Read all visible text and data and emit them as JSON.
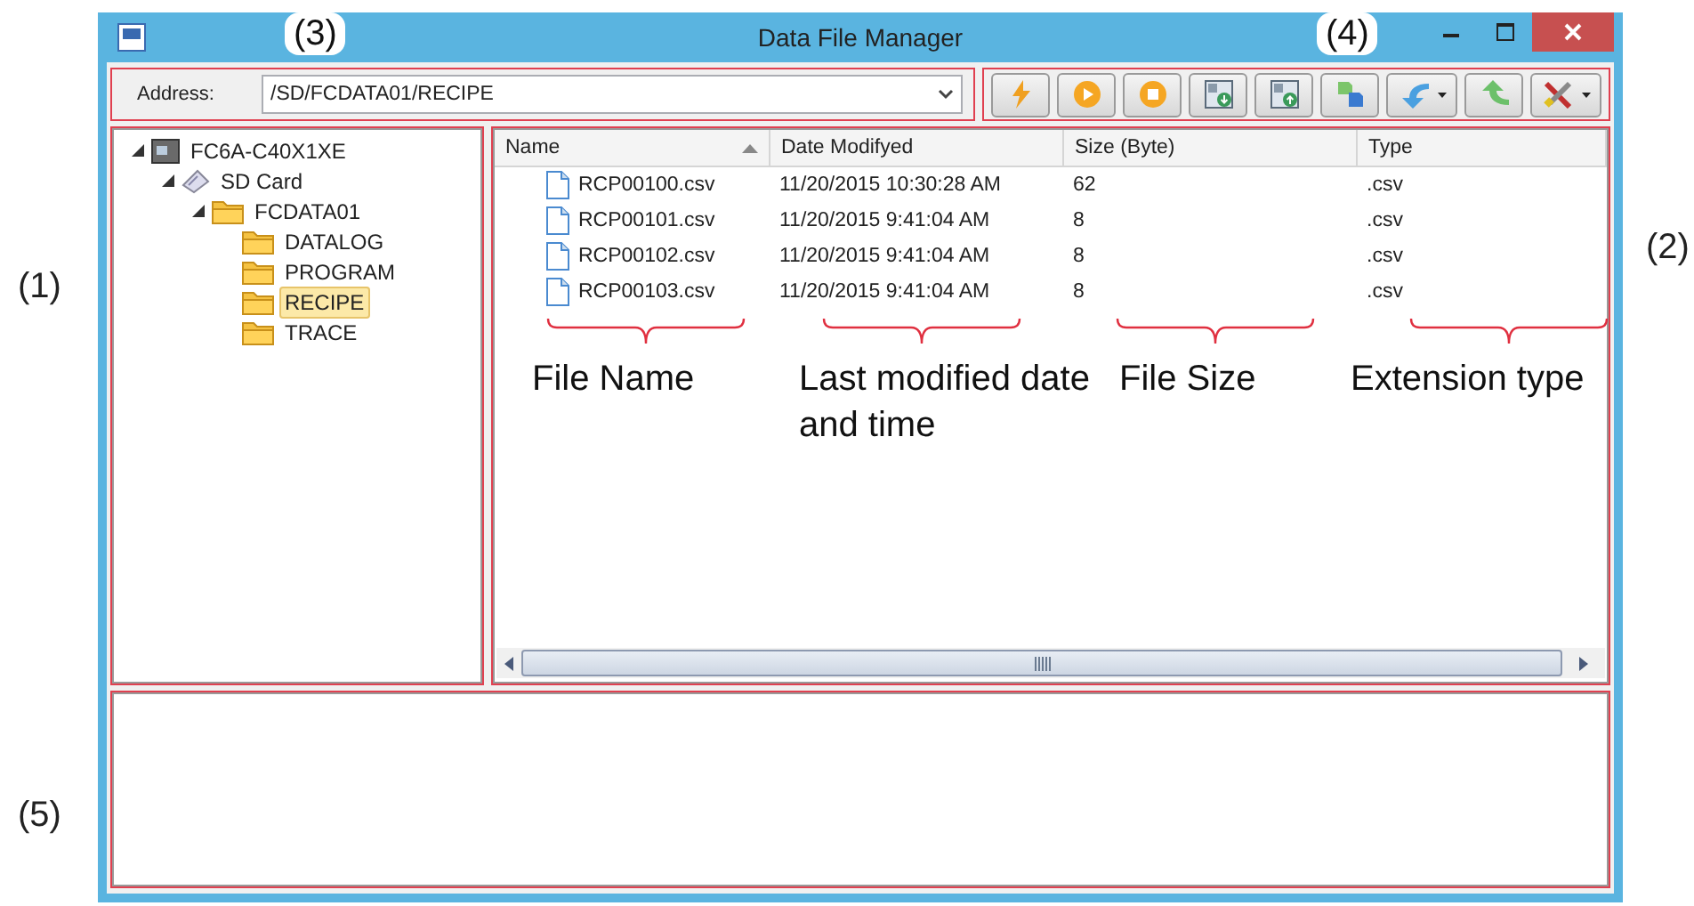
{
  "window": {
    "title": "Data File Manager"
  },
  "address_bar": {
    "callout": "(3)",
    "label": "Address:",
    "value": "/SD/FCDATA01/RECIPE"
  },
  "toolbar": {
    "callout": "(4)",
    "buttons": [
      {
        "kind": "plain"
      },
      {
        "kind": "plain"
      },
      {
        "kind": "plain"
      },
      {
        "kind": "plain"
      },
      {
        "kind": "plain"
      },
      {
        "kind": "plain"
      },
      {
        "kind": "split"
      },
      {
        "kind": "plain"
      },
      {
        "kind": "split"
      }
    ]
  },
  "tree": {
    "callout": "(1)",
    "items": [
      {
        "label": "FC6A-C40X1XE",
        "kind": "device",
        "expanded": true,
        "selected": false,
        "children": [
          {
            "label": "SD Card",
            "kind": "card",
            "expanded": true,
            "selected": false,
            "children": [
              {
                "label": "FCDATA01",
                "kind": "folder",
                "expanded": true,
                "selected": false,
                "children": [
                  {
                    "label": "DATALOG",
                    "kind": "folder",
                    "selected": false
                  },
                  {
                    "label": "PROGRAM",
                    "kind": "folder",
                    "selected": false
                  },
                  {
                    "label": "RECIPE",
                    "kind": "folder",
                    "selected": true
                  },
                  {
                    "label": "TRACE",
                    "kind": "folder",
                    "selected": false
                  }
                ]
              }
            ]
          }
        ]
      }
    ]
  },
  "file_list": {
    "callout": "(2)",
    "columns": [
      {
        "label": "Name",
        "sorted": true
      },
      {
        "label": "Date Modifyed",
        "sorted": false
      },
      {
        "label": "Size  (Byte)",
        "sorted": false
      },
      {
        "label": "Type",
        "sorted": false
      }
    ],
    "rows": [
      {
        "name": "RCP00100.csv",
        "date": "11/20/2015 10:30:28 AM",
        "size": "62",
        "type": ".csv"
      },
      {
        "name": "RCP00101.csv",
        "date": "11/20/2015 9:41:04 AM",
        "size": "8",
        "type": ".csv"
      },
      {
        "name": "RCP00102.csv",
        "date": "11/20/2015 9:41:04 AM",
        "size": "8",
        "type": ".csv"
      },
      {
        "name": "RCP00103.csv",
        "date": "11/20/2015 9:41:04 AM",
        "size": "8",
        "type": ".csv"
      }
    ],
    "column_notes": [
      "File Name",
      "Last modified date and time",
      "File Size",
      "Extension type"
    ]
  },
  "output_panel": {
    "callout": "(5)"
  }
}
